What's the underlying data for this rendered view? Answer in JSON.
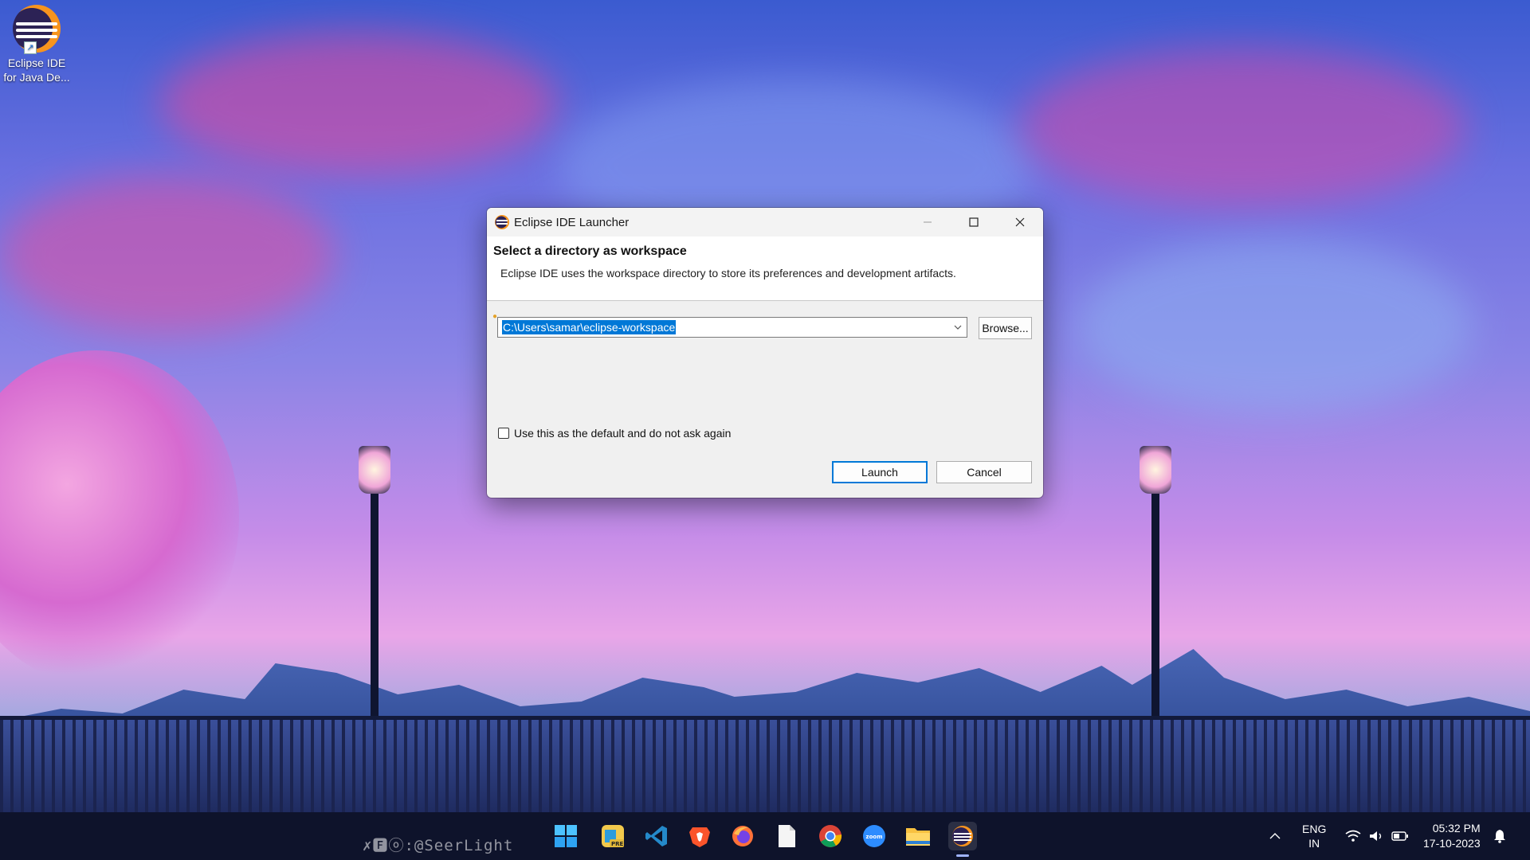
{
  "desktop": {
    "shortcut": {
      "label_line1": "Eclipse IDE",
      "label_line2": "for Java De...",
      "icon": "eclipse-icon"
    },
    "watermark": "✗🅵ⓞ:@SeerLight"
  },
  "dialog": {
    "title": "Eclipse IDE Launcher",
    "heading": "Select a directory as workspace",
    "description": "Eclipse IDE uses the workspace directory to store its preferences and development artifacts.",
    "workspace_path": "C:\\Users\\samar\\eclipse-workspace",
    "browse_label": "Browse...",
    "default_checkbox_label": "Use this as the default and do not ask again",
    "default_checked": false,
    "launch_label": "Launch",
    "cancel_label": "Cancel"
  },
  "taskbar": {
    "apps": [
      {
        "name": "start",
        "icon": "windows-icon"
      },
      {
        "name": "pdf-reader",
        "icon": "pdf-app-icon",
        "badge": "PRE"
      },
      {
        "name": "vscode",
        "icon": "vscode-icon"
      },
      {
        "name": "brave",
        "icon": "brave-icon"
      },
      {
        "name": "firefox",
        "icon": "firefox-icon"
      },
      {
        "name": "notepad",
        "icon": "file-icon"
      },
      {
        "name": "chrome",
        "icon": "chrome-icon"
      },
      {
        "name": "zoom",
        "icon": "zoom-icon",
        "label": "zoom"
      },
      {
        "name": "file-explorer",
        "icon": "folder-icon"
      },
      {
        "name": "eclipse",
        "icon": "eclipse-icon",
        "active": true
      }
    ],
    "tray": {
      "language_line1": "ENG",
      "language_line2": "IN",
      "time": "05:32 PM",
      "date": "17-10-2023"
    }
  },
  "colors": {
    "selection": "#0078d7",
    "eclipse_orange": "#f7941e",
    "eclipse_purple": "#2c2255"
  }
}
